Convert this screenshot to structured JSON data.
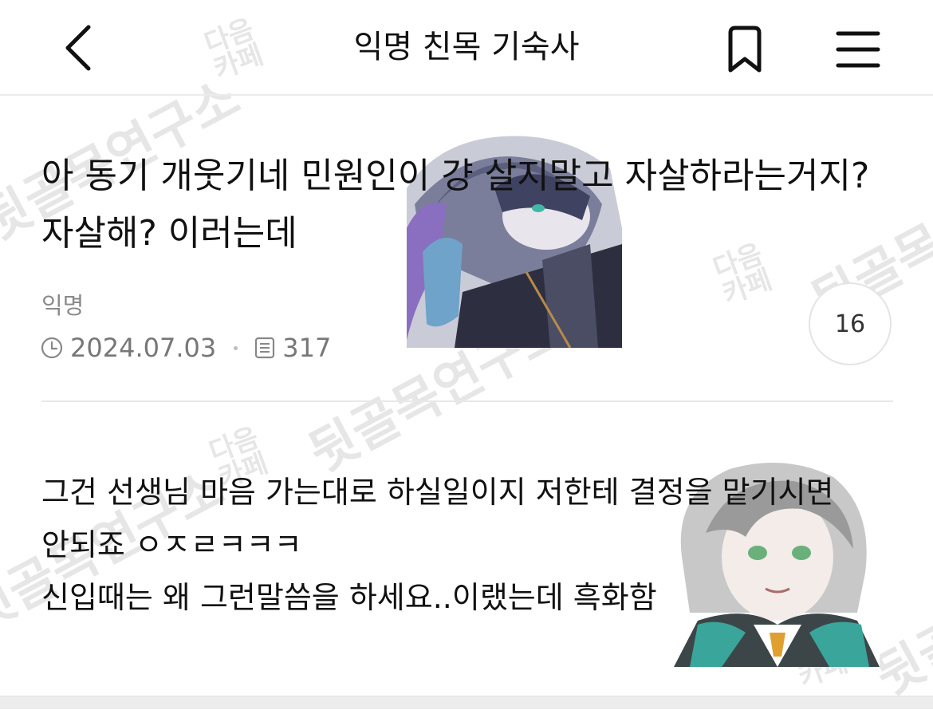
{
  "header": {
    "title": "익명 친목 기숙사",
    "back_icon": "chevron-left-icon",
    "bookmark_icon": "bookmark-icon",
    "menu_icon": "hamburger-menu-icon"
  },
  "post": {
    "title": "아 동기 개웃기네 민원인이 걍 살지말고 자살하라는거지? 자살해? 이러는데",
    "author": "익명",
    "date": "2024.07.03",
    "views": "317",
    "comment_count": "16",
    "clock_icon": "clock-icon",
    "views_icon": "document-icon"
  },
  "content": {
    "lines": [
      "그건 선생님 마음 가는대로 하실일이지 저한테 결정을 맡기시면",
      "안되죠 ㅇㅈㄹㅋㅋㅋ",
      "신입때는 왜 그런말씀을 하세요..이랬는데 흑화함"
    ]
  },
  "watermarks": {
    "main_text": "뒷골목연구소",
    "small_text_top": "다음",
    "small_text_bottom": "카페"
  },
  "colors": {
    "text_primary": "#111111",
    "text_secondary": "#777777",
    "divider": "#e8e8e8",
    "watermark": "#e6e6e6"
  }
}
